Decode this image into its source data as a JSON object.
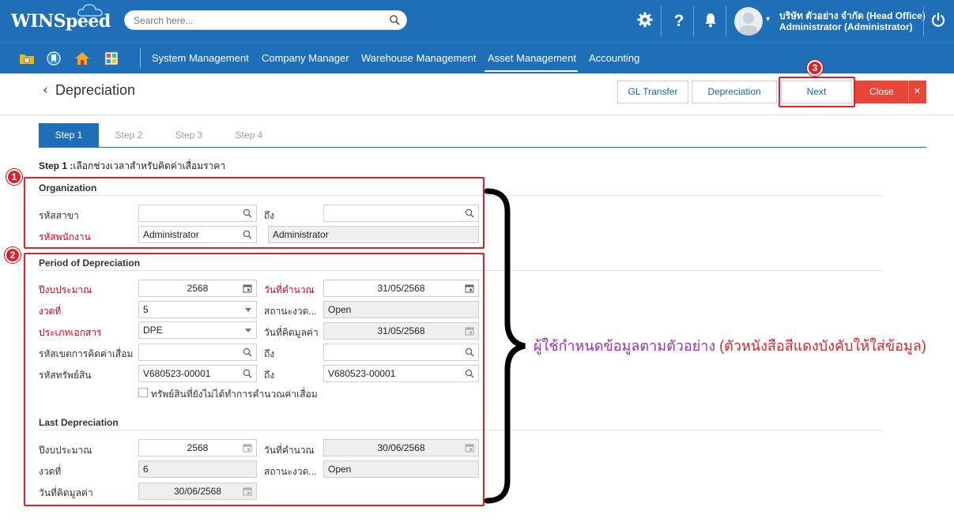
{
  "app": {
    "logo_text": "WINSpeed"
  },
  "search": {
    "placeholder": "Search here..."
  },
  "user": {
    "company": "บริษัท ตัวอย่าง จำกัด (Head Office)",
    "name": "Administrator (Administrator)"
  },
  "menu": {
    "items": [
      "System Management",
      "Company Manager",
      "Warehouse Management",
      "Asset Management",
      "Accounting"
    ],
    "active": "Asset Management"
  },
  "page": {
    "title": "Depreciation"
  },
  "buttons": {
    "gl_transfer": "GL Transfer",
    "depreciation": "Depreciation",
    "next": "Next",
    "close": "Close",
    "close_x": "✕"
  },
  "steps": {
    "items": [
      "Step 1",
      "Step 2",
      "Step 3",
      "Step 4"
    ],
    "active": "Step 1"
  },
  "step1": {
    "label": "Step 1 :",
    "description": "เลือกช่วงเวลาสำหรับคิดค่าเสื่อมราคา"
  },
  "organization": {
    "title": "Organization",
    "branch_label": "รหัสสาขา",
    "branch_value": "",
    "to_label": "ถึง",
    "branch_to_value": "",
    "employee_label": "รหัสพนักงาน",
    "employee_value": "Administrator",
    "employee_name": "Administrator"
  },
  "period": {
    "title": "Period of Depreciation",
    "fiscal_year_label": "ปีงบประมาณ",
    "fiscal_year": "2568",
    "calc_date_label": "วันที่คำนวณ",
    "calc_date": "31/05/2568",
    "period_label": "งวดที่",
    "period": "5",
    "period_status_label": "สถานะงวด...",
    "period_status": "Open",
    "doc_type_label": "ประเภทเอกสาร",
    "doc_type": "DPE",
    "value_date_label": "วันที่คิดมูลค่า",
    "value_date": "31/05/2568",
    "zone_label": "รหัสเขตการคิดค่าเสื่อม",
    "zone_from": "",
    "zone_to_label": "ถึง",
    "zone_to": "",
    "asset_label": "รหัสทรัพย์สิน",
    "asset_from": "V680523-00001",
    "asset_to_label": "ถึง",
    "asset_to": "V680523-00001",
    "checkbox_label": "ทรัพย์สินที่ยังไม่ได้ทำการคำนวณค่าเสื่อม",
    "checkbox_checked": false
  },
  "last": {
    "title": "Last Depreciation",
    "fiscal_year_label": "ปีงบประมาณ",
    "fiscal_year": "2568",
    "calc_date_label": "วันที่คำนวณ",
    "calc_date": "30/06/2568",
    "period_label": "งวดที่",
    "period": "6",
    "period_status_label": "สถานะงวด...",
    "period_status": "Open",
    "value_date_label": "วันที่คิดมูลค่า",
    "value_date": "30/06/2568"
  },
  "annotations": {
    "badge1": "1",
    "badge2": "2",
    "badge3": "3",
    "note_main": "ผู้ใช้กำหนดข้อมูลตามตัวอย่าง ",
    "note_red": "(ตัวหนังสือสีแดงบังคับให้ใส่ข้อมูล)"
  },
  "colors": {
    "primary": "#1f6fb8",
    "danger": "#e9463a",
    "required": "#d0021b",
    "annotation": "#9b2fb3"
  }
}
